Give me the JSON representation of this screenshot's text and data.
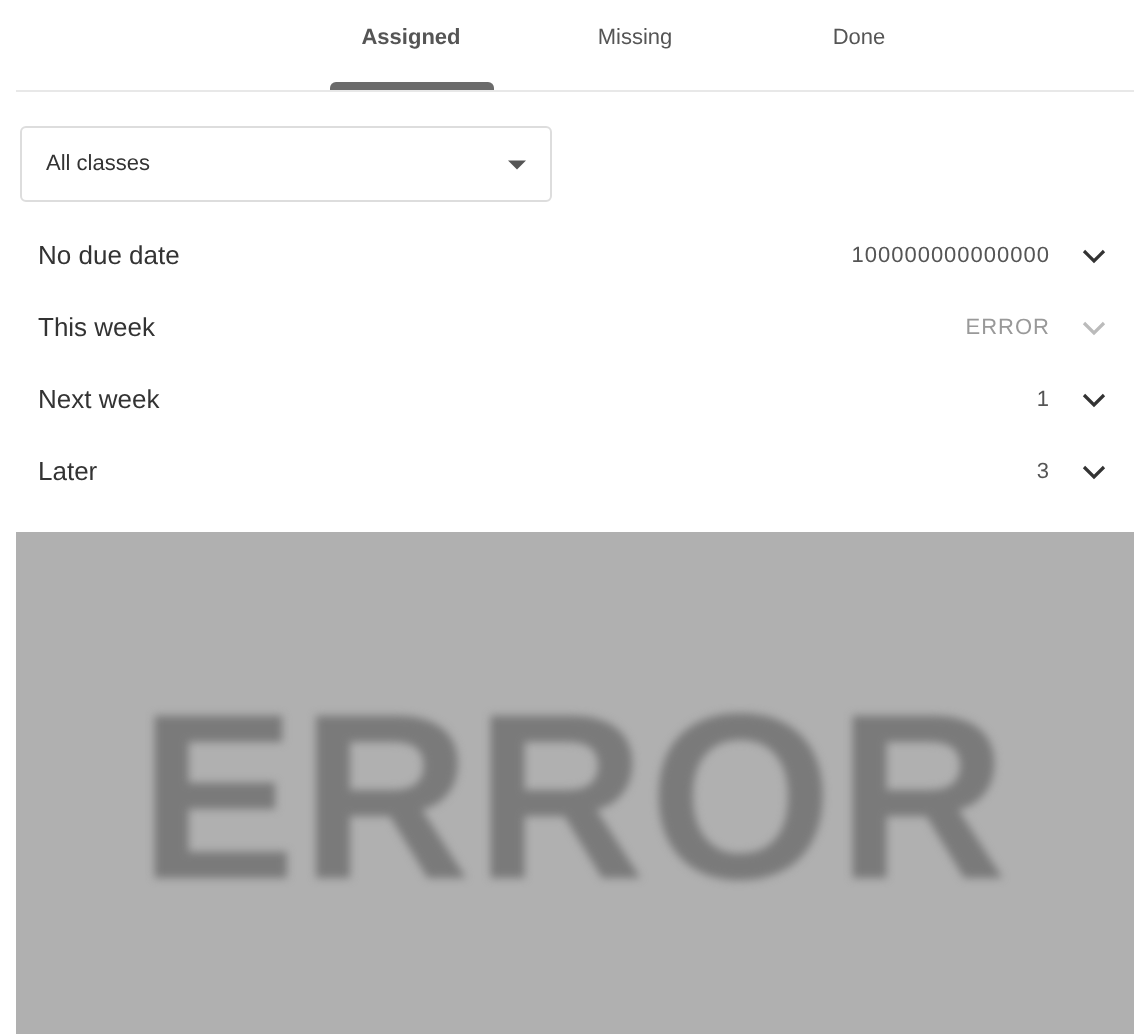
{
  "tabs": [
    {
      "label": "Assigned",
      "selected": true
    },
    {
      "label": "Missing",
      "selected": false
    },
    {
      "label": "Done",
      "selected": false
    }
  ],
  "class_filter": {
    "value": "All classes"
  },
  "sections": [
    {
      "label": "No due date",
      "count": "100000000000000",
      "disabled": false
    },
    {
      "label": "This week",
      "count": "ERROR",
      "disabled": true
    },
    {
      "label": "Next week",
      "count": "1",
      "disabled": false
    },
    {
      "label": "Later",
      "count": "3",
      "disabled": false
    }
  ],
  "error_banner": {
    "text": "ERROR"
  }
}
